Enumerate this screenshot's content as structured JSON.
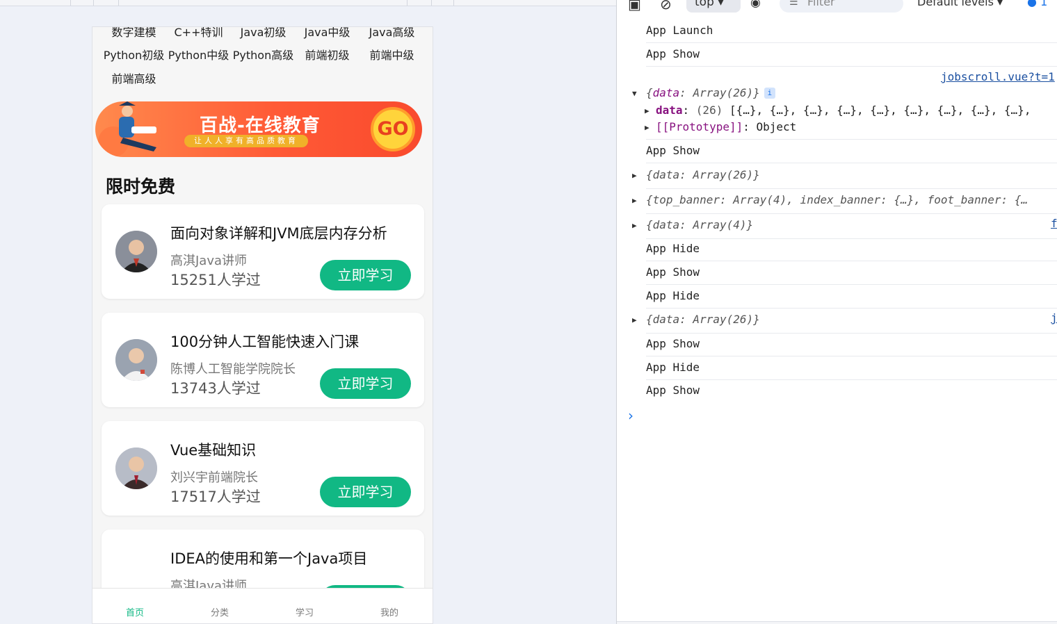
{
  "emulator": {
    "categories_row0": [
      "数字建模",
      "C++特训",
      "Java初级",
      "Java中级",
      "Java高级"
    ],
    "categories_row1": [
      "Python初级",
      "Python中级",
      "Python高级",
      "前端初级",
      "前端中级"
    ],
    "categories_row2": [
      "前端高级"
    ],
    "banner": {
      "title": "百战-在线教育",
      "subtitle": "让人人享有高品质教育",
      "go": "GO"
    },
    "section_title": "限时免费",
    "courses": [
      {
        "title": "面向对象详解和JVM底层内存分析",
        "teacher": "高淇Java讲师",
        "count": "15251人学过",
        "button": "立即学习"
      },
      {
        "title": "100分钟人工智能快速入门课",
        "teacher": "陈博人工智能学院院长",
        "count": "13743人学过",
        "button": "立即学习"
      },
      {
        "title": "Vue基础知识",
        "teacher": "刘兴宇前端院长",
        "count": "17517人学过",
        "button": "立即学习"
      },
      {
        "title": "IDEA的使用和第一个Java项目",
        "teacher": "高淇Java讲师",
        "count": "",
        "button": ""
      }
    ],
    "tabs": [
      "首页",
      "分类",
      "学习",
      "我的"
    ],
    "active_tab": "首页",
    "accent_color": "#11b884"
  },
  "devtools": {
    "toolbar": {
      "context": "top",
      "filter_placeholder": "Filter",
      "levels": "Default levels",
      "issues": "1"
    },
    "logs": {
      "l1": "App Launch",
      "l2": "App Show",
      "l3_source": "jobscroll.vue?t=1",
      "l3_summary_key": "data",
      "l3_summary_val": "Array(26)",
      "l3_data_key": "data",
      "l3_data_count": "(26)",
      "l3_data_items": "[{…}, {…}, {…}, {…}, {…}, {…}, {…}, {…}, {…},",
      "l3_proto": "[[Prototype]]",
      "l3_proto_val": "Object",
      "l4": "App Show",
      "l5": "{data: Array(26)}",
      "l6": "{top_banner: Array(4), index_banner: {…}, foot_banner: {…",
      "l7": "{data: Array(4)}",
      "l7_source": "f",
      "l8": "App Hide",
      "l9": "App Show",
      "l10": "App Hide",
      "l11": "{data: Array(26)}",
      "l11_source": "j",
      "l12": "App Show",
      "l13": "App Hide",
      "l14": "App Show"
    }
  }
}
